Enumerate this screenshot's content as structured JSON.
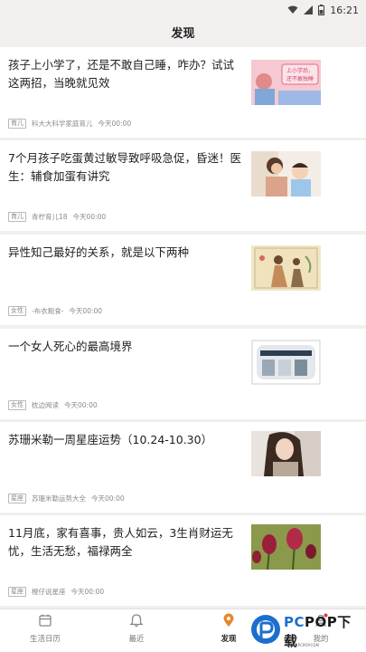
{
  "status_bar": {
    "time": "16:21",
    "icons": [
      "wifi-icon",
      "signal-icon",
      "battery-icon"
    ]
  },
  "header": {
    "title": "发现"
  },
  "feed": {
    "items": [
      {
        "title": "孩子上小学了，还是不敢自己睡，咋办？试试这两招，当晚就见效",
        "tag": "育儿",
        "source": "科大大科学家庭育儿",
        "time": "今天00:00",
        "thumb_text": "上小学后，还不敢独睡"
      },
      {
        "title": "7个月孩子吃蛋黄过敏导致呼吸急促，昏迷！医生：辅食加蛋有讲究",
        "tag": "育儿",
        "source": "青柠育儿18",
        "time": "今天00:00"
      },
      {
        "title": "异性知己最好的关系，就是以下两种",
        "tag": "女性",
        "source": "-布衣粗食-",
        "time": "今天00:00"
      },
      {
        "title": "一个女人死心的最高境界",
        "tag": "女性",
        "source": "枕边阅读",
        "time": "今天00:00"
      },
      {
        "title": "苏珊米勒一周星座运势（10.24-10.30）",
        "tag": "星座",
        "source": "苏珊米勒运势大全",
        "time": "今天00:00"
      },
      {
        "title": "11月底，家有喜事，贵人如云，3生肖财运无忧，生活无愁，福禄两全",
        "tag": "星座",
        "source": "橙仔说星座",
        "time": "今天00:00"
      }
    ]
  },
  "tabbar": {
    "tabs": [
      {
        "label": "生活日历",
        "icon": "calendar-icon",
        "active": false
      },
      {
        "label": "最近",
        "icon": "bell-icon",
        "active": false
      },
      {
        "label": "发现",
        "icon": "location-pin-icon",
        "active": true
      },
      {
        "label": "我的",
        "icon": "person-icon",
        "active": false
      }
    ]
  },
  "watermark": {
    "text_pc": "PC",
    "text_rest": "POP下载",
    "sub": "WWW.PCPOP.COM"
  },
  "colors": {
    "background": "#f3efef",
    "card": "#ffffff",
    "active_tab_icon": "#e8862a",
    "watermark_blue": "#1c6fcf"
  }
}
